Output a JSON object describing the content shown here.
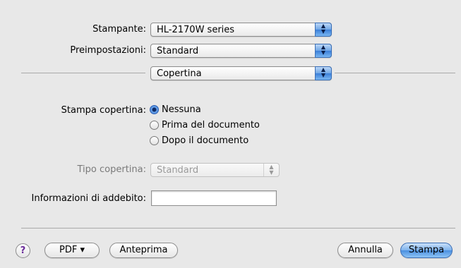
{
  "printer": {
    "label": "Stampante:",
    "value": "HL-2170W series"
  },
  "presets": {
    "label": "Preimpostazioni:",
    "value": "Standard"
  },
  "panel": {
    "value": "Copertina"
  },
  "cover_print": {
    "label": "Stampa copertina:",
    "options": [
      "Nessuna",
      "Prima del documento",
      "Dopo il documento"
    ],
    "selected": "Nessuna"
  },
  "cover_type": {
    "label": "Tipo copertina:",
    "value": "Standard"
  },
  "billing": {
    "label": "Informazioni di addebito:",
    "value": ""
  },
  "icons": {
    "popup_arrows": "up-down-arrows-icon",
    "help": "question-mark-icon"
  },
  "buttons": {
    "help": "?",
    "pdf": "PDF ▾",
    "preview": "Anteprima",
    "cancel": "Annulla",
    "print": "Stampa"
  }
}
